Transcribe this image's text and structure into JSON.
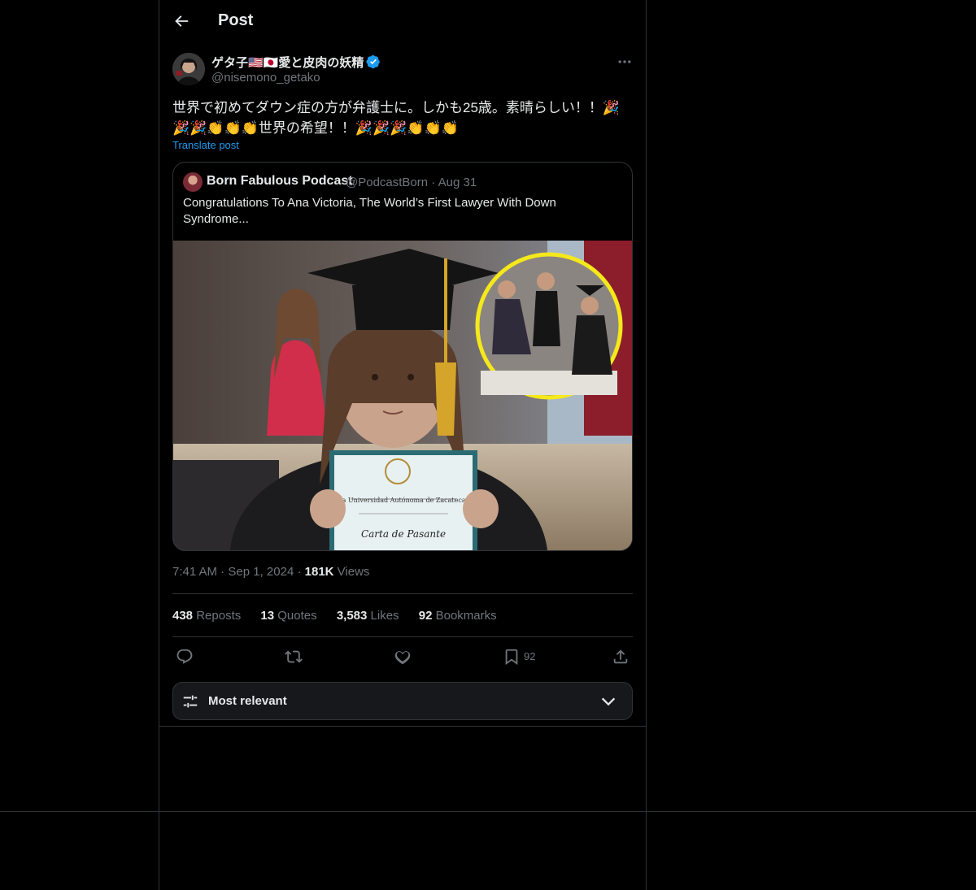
{
  "header": {
    "title": "Post"
  },
  "post": {
    "display_name": "ゲタ子🇺🇸🇯🇵愛と皮肉の妖精",
    "handle": "@nisemono_getako",
    "text": "世界で初めてダウン症の方が弁護士に。しかも25歳。素晴らしい！！🎉🎉🎉👏👏👏世界の希望！！🎉🎉🎉👏👏👏",
    "translate_label": "Translate post",
    "time": "7:41 AM",
    "date": "Sep 1, 2024",
    "views_count": "181K",
    "views_label": "Views"
  },
  "quote": {
    "display_name": "Born Fabulous Podcast",
    "handle": "@PodcastBorn",
    "date": "Aug 31",
    "text": "Congratulations To Ana Victoria, The World’s First Lawyer With Down Syndrome...",
    "image_texts": {
      "university": "La Universidad Autónoma de Zacatecas",
      "certificate": "Carta de Pasante"
    }
  },
  "stats": {
    "reposts_count": "438",
    "reposts_label": "Reposts",
    "quotes_count": "13",
    "quotes_label": "Quotes",
    "likes_count": "3,583",
    "likes_label": "Likes",
    "bookmarks_count": "92",
    "bookmarks_label": "Bookmarks"
  },
  "actions": {
    "bookmark_count": "92"
  },
  "sort": {
    "label": "Most relevant"
  },
  "icons": [
    "back-arrow-icon",
    "verified-badge-icon",
    "more-options-icon",
    "reply-icon",
    "repost-icon",
    "like-icon",
    "bookmark-icon",
    "share-icon",
    "sort-sliders-icon",
    "chevron-down-icon"
  ],
  "colors": {
    "background": "#000000",
    "accent": "#1d9bf0",
    "text": "#e7e9ea",
    "muted": "#71767b",
    "border": "#2f3336"
  }
}
